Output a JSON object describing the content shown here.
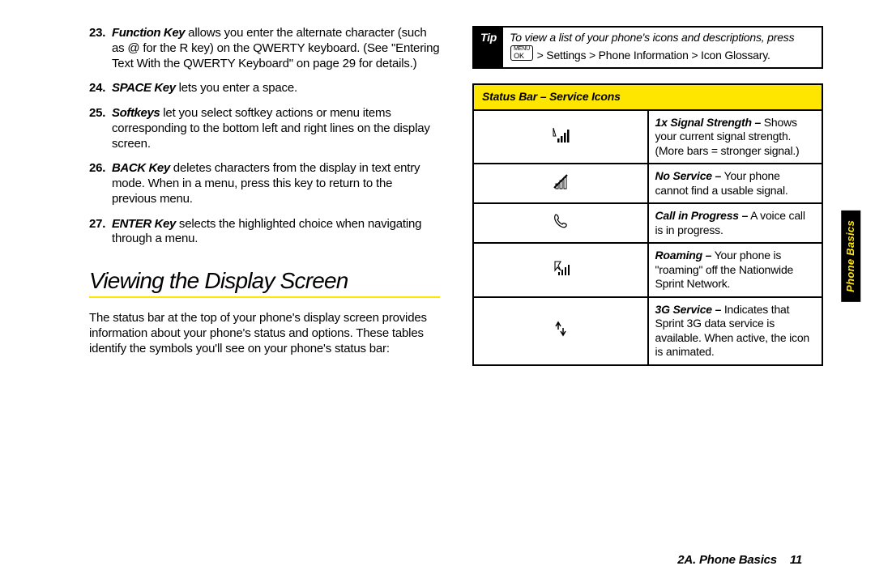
{
  "keylist": [
    {
      "term": "Function Key",
      "rest": " allows you enter the alternate character (such as @ for the R key) on the QWERTY keyboard. (See \"Entering Text With the QWERTY Keyboard\" on page 29 for details.)"
    },
    {
      "term": "SPACE Key",
      "rest": " lets you enter a space."
    },
    {
      "term": "Softkeys",
      "rest": " let you select softkey actions or menu items corresponding to the bottom left and right lines on the display screen."
    },
    {
      "term": "BACK Key",
      "rest": " deletes characters from the display in text entry mode. When in a menu, press this key to return to the previous menu."
    },
    {
      "term": "ENTER Key",
      "rest": " selects the highlighted choice when navigating through a menu."
    }
  ],
  "section_title": "Viewing the Display Screen",
  "section_para": "The status bar at the top of your phone's display screen provides information about your phone's status and options. These tables identify the symbols you'll see on your phone's status bar:",
  "tip": {
    "label": "Tip",
    "body_italic": "To view a list of your phone's icons and descriptions, press ",
    "body_norm_pre": "",
    "path": " > Settings > Phone Information > Icon Glossary."
  },
  "table": {
    "header": "Status Bar – Service Icons",
    "rows": [
      {
        "icon": "signal",
        "b": "1x Signal Strength –",
        "rest": " Shows your current signal strength. (More bars = stronger signal.)"
      },
      {
        "icon": "noservice",
        "b": "No Service –",
        "rest": " Your phone cannot find a usable signal."
      },
      {
        "icon": "call",
        "b": "Call in Progress –",
        "rest": " A voice call is in progress."
      },
      {
        "icon": "roaming",
        "b": "Roaming –",
        "rest": " Your phone is \"roaming\" off the Nationwide Sprint Network."
      },
      {
        "icon": "threeg",
        "b": "3G Service –",
        "rest": " Indicates that Sprint 3G data service is available. When active, the icon is animated."
      }
    ]
  },
  "sidetab": "Phone Basics",
  "footer": {
    "left": "2A. Phone Basics",
    "right": "11"
  }
}
